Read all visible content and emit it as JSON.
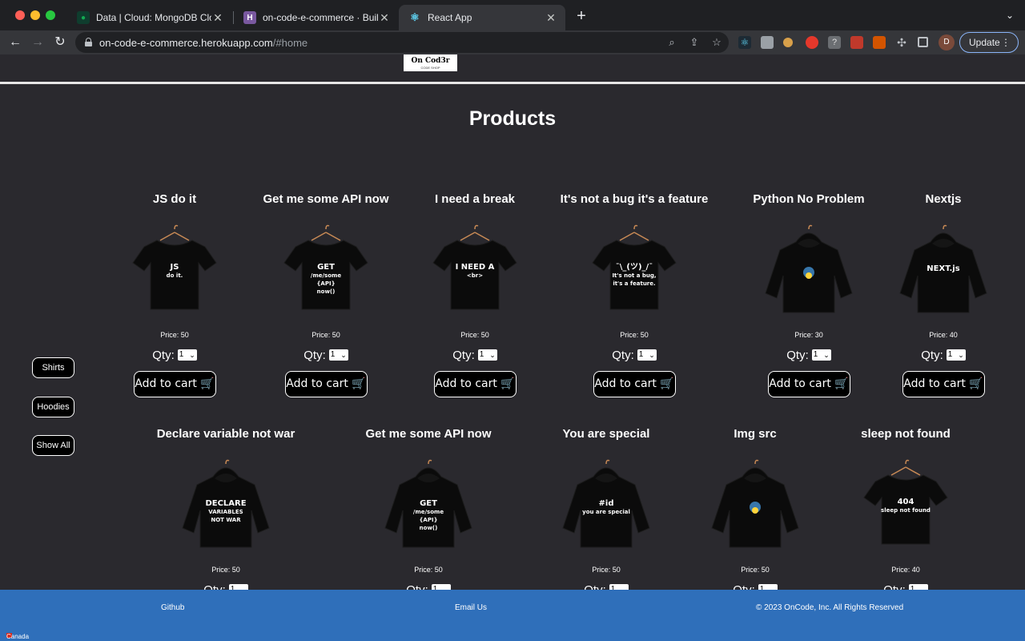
{
  "browser": {
    "tabs": [
      {
        "title": "Data | Cloud: MongoDB Cloud",
        "icon": "mongodb-leaf-icon"
      },
      {
        "title": "on-code-e-commerce · Build |",
        "icon": "heroku-icon"
      },
      {
        "title": "React App",
        "icon": "react-icon"
      }
    ],
    "new_tab": "+",
    "tab_menu": "⌄",
    "url_host": "on-code-e-commerce.herokuapp.com",
    "url_path": "/#home",
    "profile_initial": "D",
    "update_label": "Update",
    "update_menu": "⋮"
  },
  "header": {
    "logo_text": "On Cod3r",
    "logo_sub": "CODE SHOP"
  },
  "main": {
    "title": "Products",
    "filters": [
      "Shirts",
      "Hoodies",
      "Show All"
    ],
    "qty_label": "Qty:",
    "qty_default": "1",
    "add_to_cart": "Add to cart 🛒",
    "products": [
      {
        "name": "JS do it",
        "price": "Price: 50",
        "kind": "shirt",
        "print": [
          "JS",
          "do it."
        ]
      },
      {
        "name": "Get me some API now",
        "price": "Price: 50",
        "kind": "shirt",
        "print": [
          "GET",
          "/me/some",
          "{API}",
          "now()"
        ]
      },
      {
        "name": "I need a break",
        "price": "Price: 50",
        "kind": "shirt",
        "print": [
          "I NEED A",
          "<br>"
        ]
      },
      {
        "name": "It's not a bug it's a feature",
        "price": "Price: 50",
        "kind": "shirt",
        "print": [
          "¯\\_(ツ)_/¯",
          "It's not a bug,",
          "it's a feature."
        ]
      },
      {
        "name": "Python No Problem",
        "price": "Price: 30",
        "kind": "hoodie",
        "print": []
      },
      {
        "name": "Nextjs",
        "price": "Price: 40",
        "kind": "hoodie",
        "print": [
          "NEXT.js"
        ]
      },
      {
        "name": "Declare variable not war",
        "price": "Price: 50",
        "kind": "hoodie",
        "print": [
          "DECLARE",
          "VARIABLES",
          "NOT WAR"
        ]
      },
      {
        "name": "Get me some API now",
        "price": "Price: 50",
        "kind": "hoodie",
        "print": [
          "GET",
          "/me/some",
          "{API}",
          "now()"
        ]
      },
      {
        "name": "You are special",
        "price": "Price: 50",
        "kind": "hoodie",
        "print": [
          "#id",
          "you are special"
        ]
      },
      {
        "name": "Img src",
        "price": "Price: 50",
        "kind": "hoodie",
        "print": []
      },
      {
        "name": "sleep not found",
        "price": "Price: 40",
        "kind": "shirt",
        "print": [
          "404",
          "sleep not found"
        ]
      }
    ]
  },
  "footer": {
    "github": "Github",
    "email": "Email Us",
    "copyright": "© 2023 OnCode, Inc. All Rights Reserved",
    "country": "Canada"
  },
  "colors": {
    "page_bg": "#2a292e",
    "footer_bg": "#2f6fba",
    "button_bg": "#000000",
    "tab_active": "#35363a"
  }
}
